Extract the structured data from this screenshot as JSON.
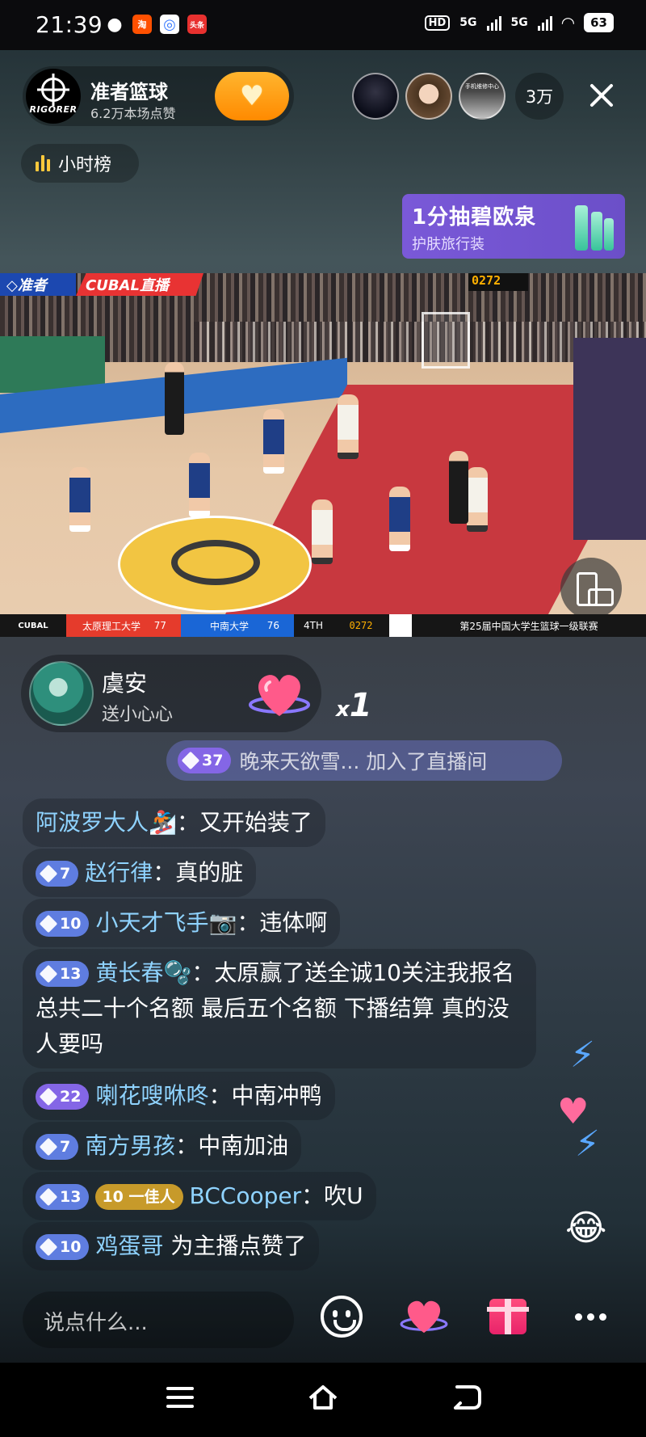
{
  "status_bar": {
    "time": "21:39",
    "app_icons": [
      {
        "name": "wechat-icon",
        "glyph": "◉",
        "color": "#ffffff"
      },
      {
        "name": "taobao-icon",
        "glyph": "淘",
        "color": "#ff5000"
      },
      {
        "name": "app-blue-icon",
        "glyph": "◎",
        "color": "#3a7bff"
      },
      {
        "name": "toutiao-icon",
        "glyph": "头条",
        "color": "#e8312f"
      }
    ],
    "hd": "HD",
    "network_1": "5G",
    "network_2": "5G",
    "battery": "63"
  },
  "header": {
    "host_logo_text": "RIGORER",
    "host_name": "准者篮球",
    "host_likes": "6.2万本场点赞",
    "follow_icon": "heart-plus-icon",
    "viewer_3_text": "手机维修中心",
    "viewer_count": "3万"
  },
  "rank": {
    "label": "小时榜"
  },
  "ad": {
    "title": "1分抽碧欧泉",
    "subtitle": "护肤旅行装"
  },
  "video": {
    "tag_left": "◇准者",
    "tag_right": "CUBAL直播",
    "shot_clock": "0272",
    "scoreboard": {
      "logo": "CUBAL",
      "team1": "太原理工大学",
      "score1": "77",
      "team2": "中南大学",
      "score2": "76",
      "quarter": "4TH",
      "clock": "0272",
      "league": "第25届中国大学生篮球一级联赛"
    }
  },
  "gift": {
    "user": "虞安",
    "action": "送小心心",
    "multiplier_x": "x",
    "multiplier_n": "1"
  },
  "join_notice": {
    "level": "37",
    "text": "晚来天欲雪... 加入了直播间"
  },
  "chat": [
    {
      "level": "",
      "tag": "",
      "user": "阿波罗大人🏂",
      "sep": "：",
      "text": "又开始装了"
    },
    {
      "level": "7",
      "tag": "",
      "user": "赵行律",
      "sep": "：",
      "text": "真的脏"
    },
    {
      "level": "10",
      "tag": "",
      "user": "小天才飞手📷",
      "sep": "：",
      "text": "违体啊"
    },
    {
      "level": "13",
      "tag": "",
      "user": "黄长春🫧",
      "sep": "：",
      "text": "太原赢了送全诚10关注我报名 总共二十个名额 最后五个名额 下播结算 真的没人要吗"
    },
    {
      "level": "22",
      "tag": "",
      "user": "喇花嗖咻咚",
      "sep": "：",
      "text": "中南冲鸭"
    },
    {
      "level": "7",
      "tag": "",
      "user": "南方男孩",
      "sep": "：",
      "text": "中南加油"
    },
    {
      "level": "13",
      "tag": "10 一佳人",
      "user": "BCCooper",
      "sep": "：",
      "text": "吹U"
    },
    {
      "level": "10",
      "tag": "",
      "user": "鸡蛋哥",
      "sep": " ",
      "text": "为主播点赞了"
    }
  ],
  "bottom": {
    "input_placeholder": "说点什么..."
  }
}
